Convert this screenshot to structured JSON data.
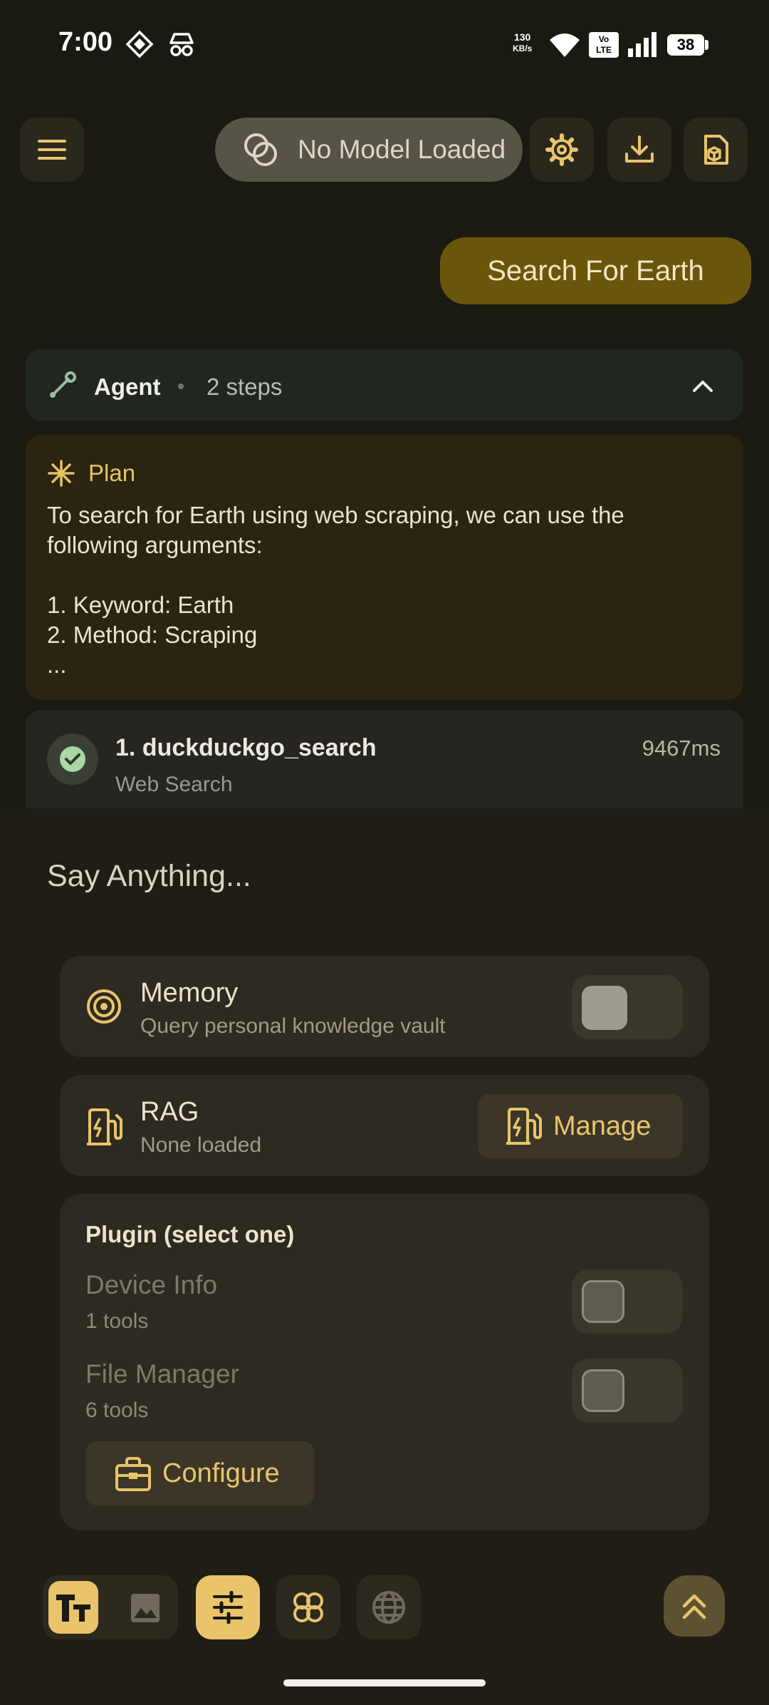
{
  "status_bar": {
    "time": "7:00",
    "net_speed_value": "130",
    "net_speed_unit": "KB/s",
    "volte_top": "Vo",
    "volte_bottom": "LTE",
    "battery": "38"
  },
  "top_bar": {
    "model_label": "No Model Loaded",
    "icons": [
      "menu-icon",
      "model-icon",
      "settings-icon",
      "download-icon",
      "package-icon"
    ]
  },
  "conversation": {
    "user_message": "Search For Earth",
    "agent": {
      "title": "Agent",
      "steps": "2 steps",
      "plan": {
        "title": "Plan",
        "text": "To search for Earth using web scraping, we can use the\nfollowing arguments:\n\n1. Keyword: Earth\n2. Method: Scraping\n..."
      },
      "tool_steps": [
        {
          "title": "1. duckduckgo_search",
          "subtitle": "Web Search",
          "duration": "9467ms",
          "status": "success"
        }
      ]
    }
  },
  "composer": {
    "placeholder": "Say Anything...",
    "memory": {
      "title": "Memory",
      "subtitle": "Query personal knowledge vault",
      "enabled": false
    },
    "rag": {
      "title": "RAG",
      "subtitle": "None loaded",
      "button": "Manage"
    },
    "plugin": {
      "heading": "Plugin (select one)",
      "items": [
        {
          "name": "Device Info",
          "tools": "1 tools",
          "enabled": false
        },
        {
          "name": "File Manager",
          "tools": "6 tools",
          "enabled": false
        }
      ],
      "configure_button": "Configure"
    }
  },
  "toolbar": {
    "buttons": [
      "text-mode-icon",
      "image-icon",
      "sliders-icon",
      "quatrefoil-icon",
      "globe-icon",
      "expand-up-icon"
    ]
  },
  "colors": {
    "accent": "#e9c46a",
    "background": "#1b1a12",
    "user_bubble": "#6a560b"
  }
}
